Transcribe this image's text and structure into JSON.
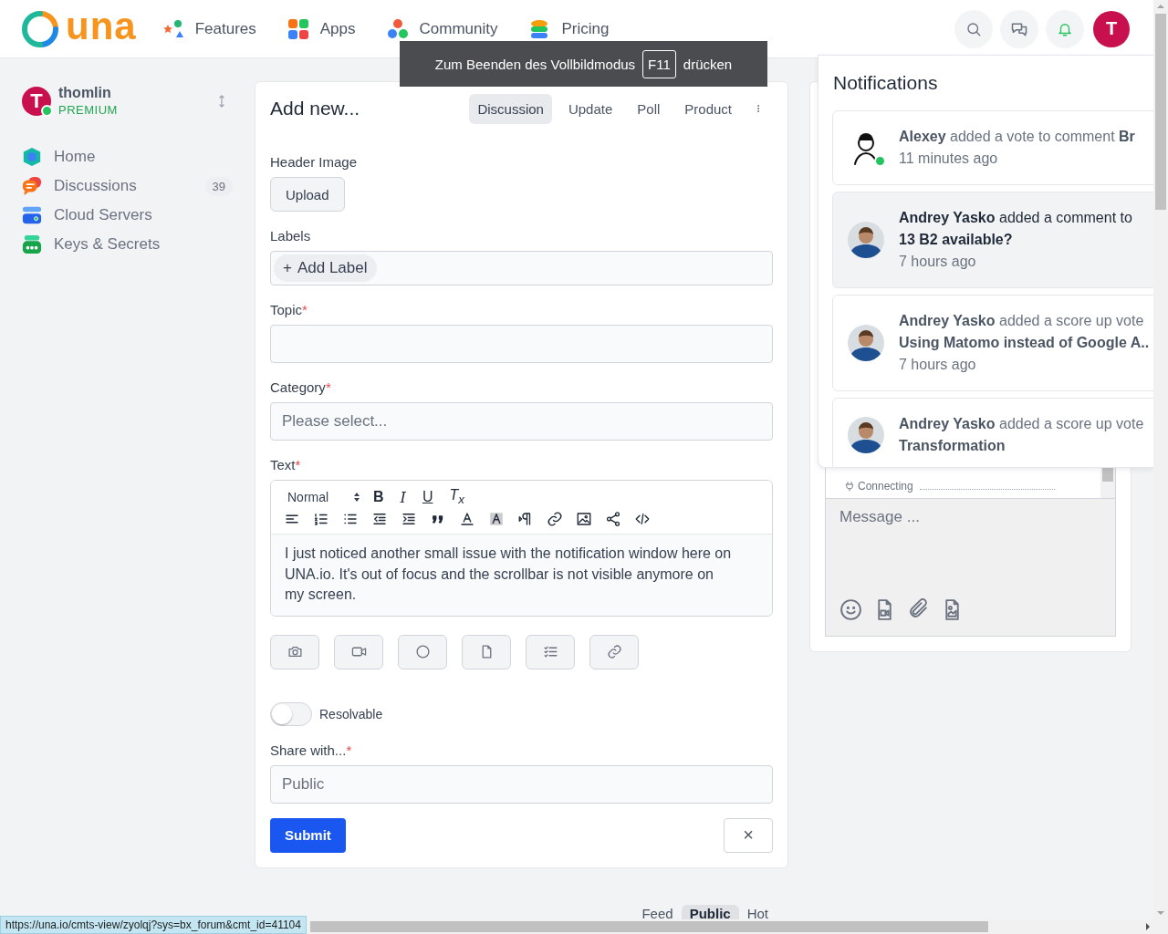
{
  "header": {
    "logo_text": "una",
    "nav": [
      {
        "label": "Features"
      },
      {
        "label": "Apps"
      },
      {
        "label": "Community"
      },
      {
        "label": "Pricing"
      }
    ],
    "avatar_letter": "T"
  },
  "fullscreen_hint": {
    "before": "Zum Beenden des Vollbildmodus",
    "key": "F11",
    "after": "drücken"
  },
  "sidebar": {
    "user": {
      "initial": "T",
      "name": "thomlin",
      "plan": "PREMIUM",
      "online": true
    },
    "items": [
      {
        "label": "Home"
      },
      {
        "label": "Discussions",
        "count": "39"
      },
      {
        "label": "Cloud Servers"
      },
      {
        "label": "Keys & Secrets"
      }
    ]
  },
  "composer": {
    "title": "Add new...",
    "tabs": [
      {
        "label": "Discussion",
        "selected": true
      },
      {
        "label": "Update",
        "selected": false
      },
      {
        "label": "Poll",
        "selected": false
      },
      {
        "label": "Product",
        "selected": false
      }
    ],
    "fields": [
      {
        "kind": "upload",
        "label": "Header Image",
        "button": "Upload"
      },
      {
        "kind": "labels",
        "label": "Labels",
        "chip_icon": "+",
        "chip": "Add Label"
      },
      {
        "kind": "input",
        "label": "Topic",
        "required_mark": "*"
      },
      {
        "kind": "select",
        "label": "Category",
        "required_mark": "*",
        "value": "Please select..."
      },
      {
        "kind": "editor",
        "label": "Text",
        "required_mark": "*",
        "block_style": "Normal",
        "format_buttons": [
          "B",
          "I",
          "U"
        ],
        "clear_format": "T$_{x}$",
        "content": "I just noticed another small issue with the notification window here on UNA.io. It's out of focus and the scrollbar is not visible anymore on my screen."
      },
      {
        "kind": "attachments"
      },
      {
        "kind": "toggle",
        "label": "Resolvable",
        "on": false
      },
      {
        "kind": "select",
        "label": "Share with...",
        "required_mark": "*",
        "value": "Public"
      }
    ],
    "submit": "Submit",
    "cancel": "×"
  },
  "chat": {
    "status": "Connecting",
    "placeholder": "Message ..."
  },
  "notifications": {
    "title": "Notifications",
    "items": [
      {
        "lines": [
          "**Alexey** added a vote to comment **Br**"
        ],
        "time": "11 minutes ago",
        "online": true,
        "unread": false,
        "kind": "sketch"
      },
      {
        "lines": [
          "**Andrey Yasko** added a comment to",
          "**13 B2 available?**"
        ],
        "time": "7 hours ago",
        "online": false,
        "unread": true,
        "kind": "photo"
      },
      {
        "lines": [
          "**Andrey Yasko** added a score up vote",
          "**Using Matomo instead of Google A..**"
        ],
        "time": "7 hours ago",
        "online": false,
        "unread": false,
        "kind": "photo"
      },
      {
        "lines": [
          "**Andrey Yasko** added a score up vote",
          "**Transformation**"
        ],
        "online": false,
        "unread": false,
        "kind": "photo"
      }
    ]
  },
  "feed": {
    "tabs": [
      {
        "label": "Feed",
        "selected": false
      },
      {
        "label": "Public",
        "selected": true
      },
      {
        "label": "Hot",
        "selected": false
      }
    ]
  },
  "status_url": "https://una.io/cmts-view/zyolqj?sys=bx_forum&cmt_id=41104"
}
